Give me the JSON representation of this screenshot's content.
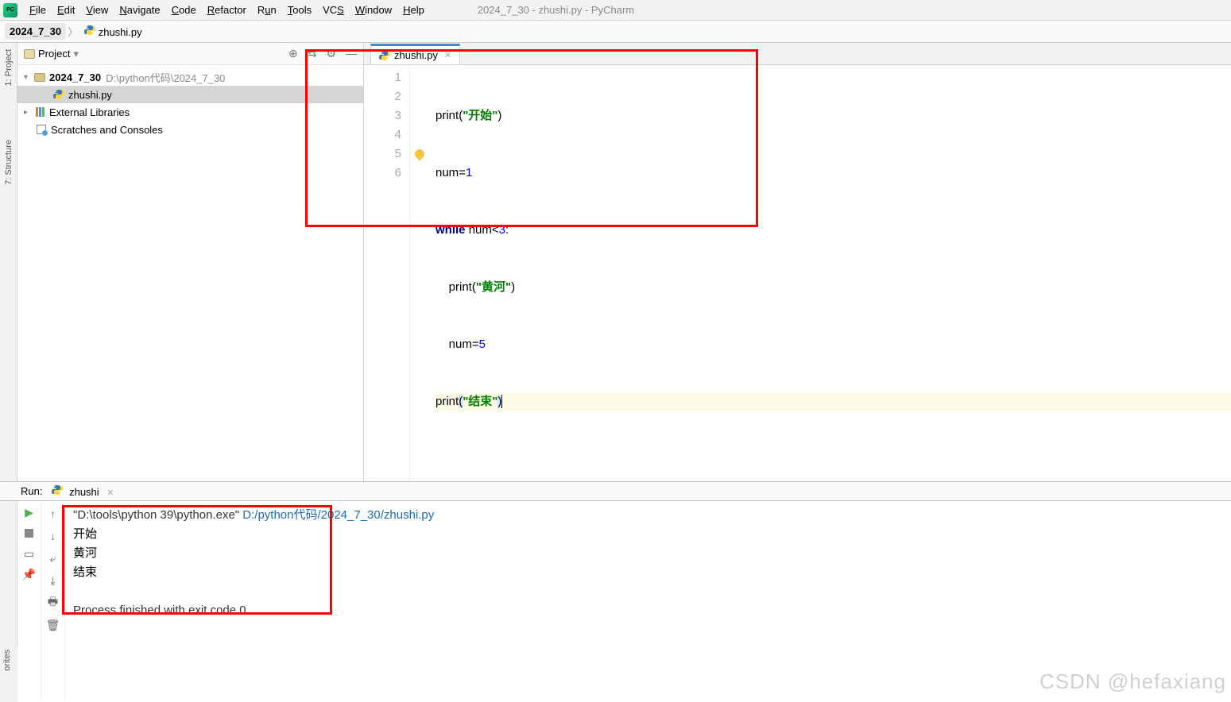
{
  "window_title": "2024_7_30 - zhushi.py - PyCharm",
  "menu": [
    "File",
    "Edit",
    "View",
    "Navigate",
    "Code",
    "Refactor",
    "Run",
    "Tools",
    "VCS",
    "Window",
    "Help"
  ],
  "breadcrumb": {
    "root": "2024_7_30",
    "file": "zhushi.py"
  },
  "sidebar": {
    "title": "Project",
    "items": {
      "root_name": "2024_7_30",
      "root_path": "D:\\python代码\\2024_7_30",
      "file": "zhushi.py",
      "ext_lib": "External Libraries",
      "scratch": "Scratches and Consoles"
    }
  },
  "leftTabs": {
    "project": "1: Project",
    "structure": "7: Structure",
    "favorites": "orites"
  },
  "tab": {
    "name": "zhushi.py"
  },
  "code": {
    "l1a": "print",
    "l1b": "(",
    "l1c": "\"开始\"",
    "l1d": ")",
    "l2a": "num=",
    "l2b": "1",
    "l3a": "while ",
    "l3b": "num<",
    "l3c": "3",
    "l3d": ":",
    "l4a": "    print(",
    "l4b": "\"黄河\"",
    "l4c": ")",
    "l5a": "    num=",
    "l5b": "5",
    "l6a": "print",
    "l6b": "(",
    "l6c": "\"结束\"",
    "l6d": ")"
  },
  "lines": [
    "1",
    "2",
    "3",
    "4",
    "5",
    "6"
  ],
  "run": {
    "label": "Run:",
    "tab": "zhushi",
    "cmd_exe": "\"D:\\tools\\python 39\\python.exe\" ",
    "cmd_script": "D:/python代码/2024_7_30/zhushi.py",
    "out1": "开始",
    "out2": "黄河",
    "out3": "结束",
    "exit": "Process finished with exit code 0"
  },
  "watermark": "CSDN @hefaxiang"
}
